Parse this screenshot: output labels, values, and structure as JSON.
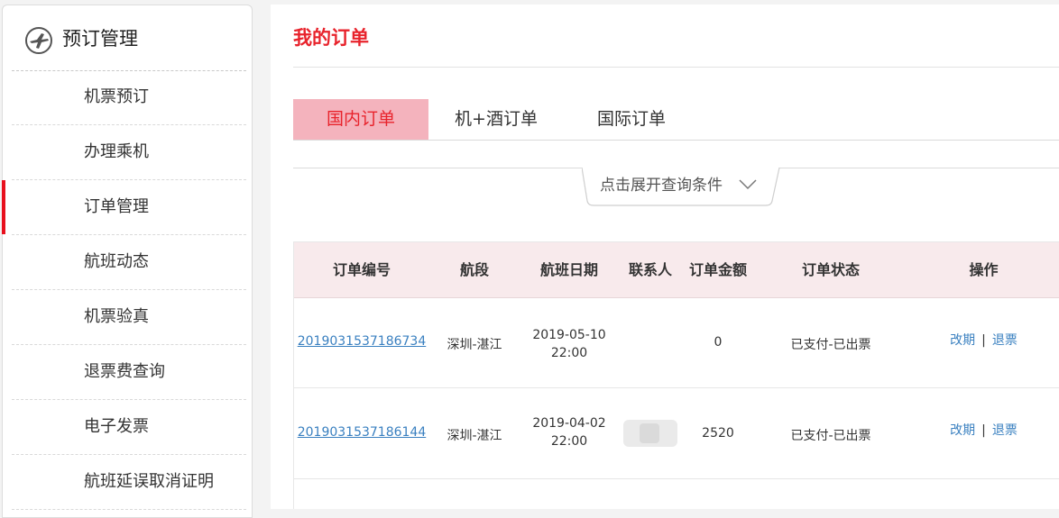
{
  "sidebar": {
    "title": "预订管理",
    "icon": "airplane-icon",
    "active_color": "#e8101d",
    "items": [
      {
        "label": "机票预订"
      },
      {
        "label": "办理乘机"
      },
      {
        "label": "订单管理",
        "active": true
      },
      {
        "label": "航班动态"
      },
      {
        "label": "机票验真"
      },
      {
        "label": "退票费查询"
      },
      {
        "label": "电子发票"
      },
      {
        "label": "航班延误取消证明"
      }
    ]
  },
  "main": {
    "title": "我的订单",
    "title_color": "#e8232c",
    "tabs": [
      {
        "label": "国内订单",
        "active": true
      },
      {
        "label": "机+酒订单"
      },
      {
        "label": "国际订单"
      }
    ],
    "filter_toggle": "点击展开查询条件",
    "table": {
      "headers": [
        "订单编号",
        "航段",
        "航班日期",
        "联系人",
        "订单金额",
        "订单状态",
        "操作"
      ],
      "rows": [
        {
          "order_no": "2019031537186734",
          "segment": "深圳-湛江",
          "date": "2019-05-10",
          "time": "22:00",
          "contact": "",
          "amount": "0",
          "status": "已支付-已出票",
          "op_change": "改期",
          "op_refund": "退票"
        },
        {
          "order_no": "2019031537186144",
          "segment": "深圳-湛江",
          "date": "2019-04-02",
          "time": "22:00",
          "contact": "",
          "amount": "2520",
          "status": "已支付-已出票",
          "op_change": "改期",
          "op_refund": "退票"
        }
      ]
    }
  }
}
